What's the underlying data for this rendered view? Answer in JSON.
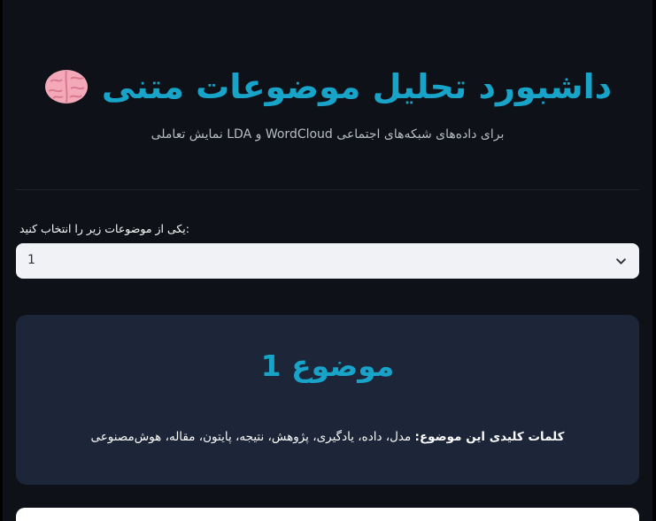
{
  "header": {
    "title": "داشبورد تحلیل موضوعات متنی",
    "title_icon": "brain-icon",
    "subtitle": "برای داده‌های شبکه‌های اجتماعی WordCloud و LDA نمایش تعاملی"
  },
  "selector": {
    "label": ":یکی از موضوعات زیر را انتخاب کنید",
    "selected_value": "1",
    "icon": "chevron-down-icon"
  },
  "topic_card": {
    "title": "موضوع 1",
    "keywords_label": "کلمات کلیدی این موضوع:",
    "keywords": "مدل، داده، یادگیری، پژوهش، نتیجه، پایتون، مقاله، هوش‌مصنوعی"
  },
  "colors": {
    "background": "#0e1117",
    "accent": "#18a3c9",
    "card": "#1c2638",
    "select_bg": "#f0f2f6"
  }
}
